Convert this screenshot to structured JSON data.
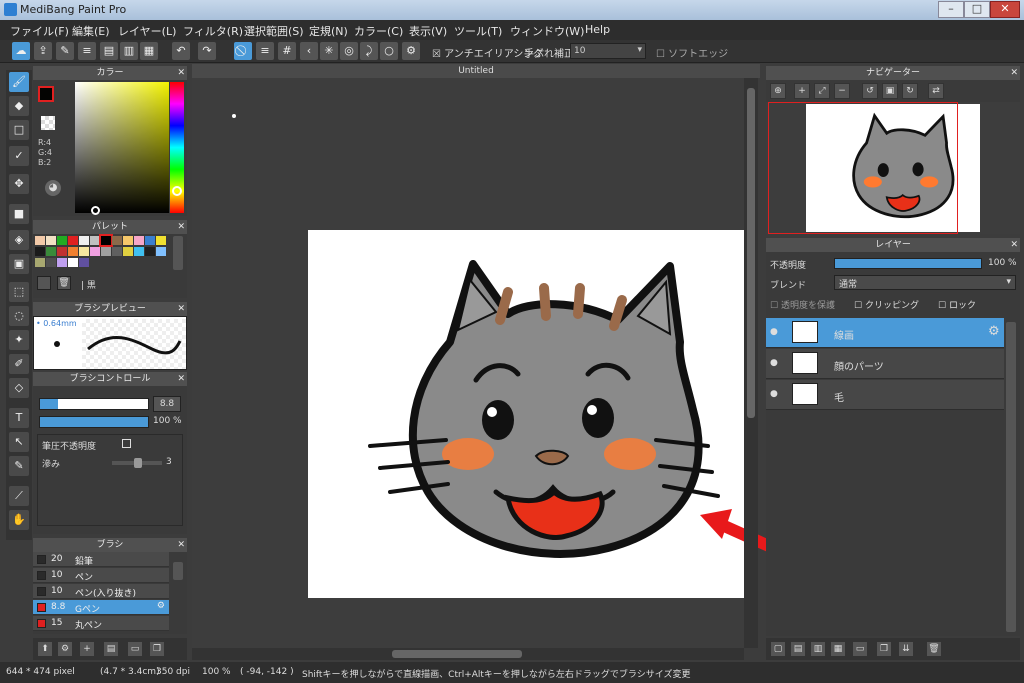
{
  "window": {
    "title": "MediBang Paint Pro"
  },
  "menu": [
    "ファイル(F)",
    "編集(E)",
    "レイヤー(L)",
    "フィルタ(R)",
    "選択範囲(S)",
    "定規(N)",
    "カラー(C)",
    "表示(V)",
    "ツール(T)",
    "ウィンドウ(W)",
    "Help"
  ],
  "toolbar": {
    "antialias_label": "アンチエイリアシング",
    "stabilizer_label": "手ぶれ補正",
    "stabilizer_value": "10",
    "soft_edge_label": "ソフトエッジ"
  },
  "canvas": {
    "tab": "Untitled"
  },
  "color_panel": {
    "title": "カラー",
    "r": "R:4",
    "g": "G:4",
    "b": "B:2"
  },
  "palette_panel": {
    "title": "パレット",
    "color_name": "黒",
    "colors": [
      "#f2c9a8",
      "#f2e0c4",
      "#22aa22",
      "#e02020",
      "#f0f0f0",
      "#c0c0c0",
      "#000000",
      "#8a6a4a",
      "#f6c86a",
      "#f7a6c8",
      "#3a7fd0",
      "#f0e030",
      "#1a1a1a",
      "#3a8a3a",
      "#c03030",
      "#f08030",
      "#f7e7a0",
      "#f0a0e0",
      "#a0a0a0",
      "#606060",
      "#e0d040",
      "#40c0f0",
      "#202020",
      "#80c0ff",
      "#a8a870",
      "#505050",
      "#c0a0f0",
      "#ffffff",
      "#6050a0"
    ]
  },
  "brush_preview": {
    "title": "ブラシプレビュー",
    "size": "0.64mm"
  },
  "brush_control": {
    "title": "ブラシコントロール",
    "size_value": "8.8",
    "opacity_value": "100 %",
    "pressure_label": "筆圧不透明度",
    "blur_label": "滲み",
    "blur_value": "3"
  },
  "brush_list": {
    "title": "ブラシ",
    "items": [
      {
        "size": "20",
        "name": "鉛筆",
        "color": "#2a2a2a"
      },
      {
        "size": "10",
        "name": "ペン",
        "color": "#2a2a2a"
      },
      {
        "size": "10",
        "name": "ペン(入り抜き)",
        "color": "#2a2a2a"
      },
      {
        "size": "8.8",
        "name": "Gペン",
        "color": "#e02020"
      },
      {
        "size": "15",
        "name": "丸ペン",
        "color": "#e02020"
      }
    ]
  },
  "navigator": {
    "title": "ナビゲーター"
  },
  "layer_panel": {
    "title": "レイヤー",
    "opacity_label": "不透明度",
    "opacity_value": "100 %",
    "blend_label": "ブレンド",
    "blend_value": "通常",
    "protect_label": "透明度を保護",
    "clipping_label": "クリッピング",
    "lock_label": "ロック",
    "layers": [
      {
        "name": "線画"
      },
      {
        "name": "顔のパーツ"
      },
      {
        "name": "毛"
      }
    ]
  },
  "status": {
    "size": "644 * 474 pixel",
    "cm": "(4.7 * 3.4cm)",
    "dpi": "350 dpi",
    "zoom": "100 %",
    "coords": "( -94, -142 )",
    "hint": "Shiftキーを押しながらで直線描画、Ctrl+Altキーを押しながら左右ドラッグでブラシサイズ変更"
  },
  "colors": {
    "accent": "#4a9ad8",
    "arrow": "#e8191b",
    "cat_body": "#8a8a8a",
    "cheek": "#ff7a30",
    "mouth": "#e83018"
  }
}
